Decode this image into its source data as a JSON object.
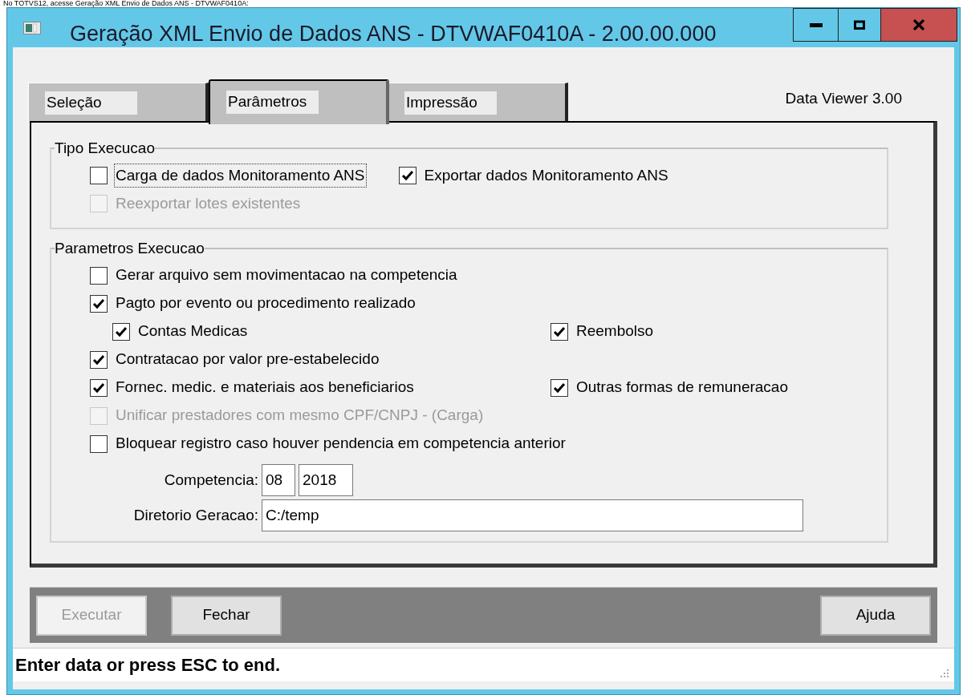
{
  "caption": "No TOTVS12, acesse Geração XML Envio de Dados ANS - DTVWAF0410A:",
  "window": {
    "title": "Geração XML Envio de Dados ANS - DTVWAF0410A - 2.00.00.000"
  },
  "tabs": [
    {
      "label": "Seleção",
      "selected": false
    },
    {
      "label": "Parâmetros",
      "selected": true
    },
    {
      "label": "Impressão",
      "selected": false
    }
  ],
  "version_label": "Data Viewer 3.00",
  "groups": [
    {
      "title": "Tipo Execucao",
      "rows": [
        [
          {
            "label": "Carga de dados Monitoramento ANS",
            "checked": false,
            "disabled": false,
            "focused": true,
            "indented": false
          },
          {
            "label": "Exportar dados Monitoramento ANS",
            "checked": true,
            "disabled": false,
            "focused": false,
            "indented": false
          }
        ],
        [
          {
            "label": "Reexportar lotes existentes",
            "checked": false,
            "disabled": true,
            "focused": false,
            "indented": false
          }
        ]
      ]
    },
    {
      "title": "Parametros Execucao",
      "rows": [
        [
          {
            "label": "Gerar arquivo sem movimentacao na competencia",
            "checked": false,
            "disabled": false,
            "focused": false,
            "indented": false
          }
        ],
        [
          {
            "label": "Pagto por evento ou procedimento realizado",
            "checked": true,
            "disabled": false,
            "focused": false,
            "indented": false
          }
        ],
        [
          {
            "label": "Contas Medicas",
            "checked": true,
            "disabled": false,
            "focused": false,
            "indented": true
          },
          {
            "label": "Reembolso",
            "checked": true,
            "disabled": false,
            "focused": false,
            "indented": false
          }
        ],
        [
          {
            "label": "Contratacao por valor pre-estabelecido",
            "checked": true,
            "disabled": false,
            "focused": false,
            "indented": false
          }
        ],
        [
          {
            "label": "Fornec. medic. e materiais aos beneficiarios",
            "checked": true,
            "disabled": false,
            "focused": false,
            "indented": false
          },
          {
            "label": "Outras formas de remuneracao",
            "checked": true,
            "disabled": false,
            "focused": false,
            "indented": false
          }
        ],
        [
          {
            "label": "Unificar prestadores com mesmo CPF/CNPJ - (Carga)",
            "checked": false,
            "disabled": true,
            "focused": false,
            "indented": false
          }
        ],
        [
          {
            "label": "Bloquear registro caso houver pendencia em competencia anterior",
            "checked": false,
            "disabled": false,
            "focused": false,
            "indented": false
          }
        ]
      ],
      "fields": [
        {
          "label": "Competencia:",
          "values": [
            "08",
            "2018"
          ]
        },
        {
          "label": "Diretorio Geracao:",
          "values": [
            "C:/temp"
          ]
        }
      ]
    }
  ],
  "buttons_left": [
    {
      "label": "Executar",
      "disabled": true
    },
    {
      "label": "Fechar",
      "disabled": false
    }
  ],
  "buttons_right": [
    {
      "label": "Ajuda",
      "disabled": false
    }
  ],
  "status_bar": "Enter data or press ESC to end."
}
